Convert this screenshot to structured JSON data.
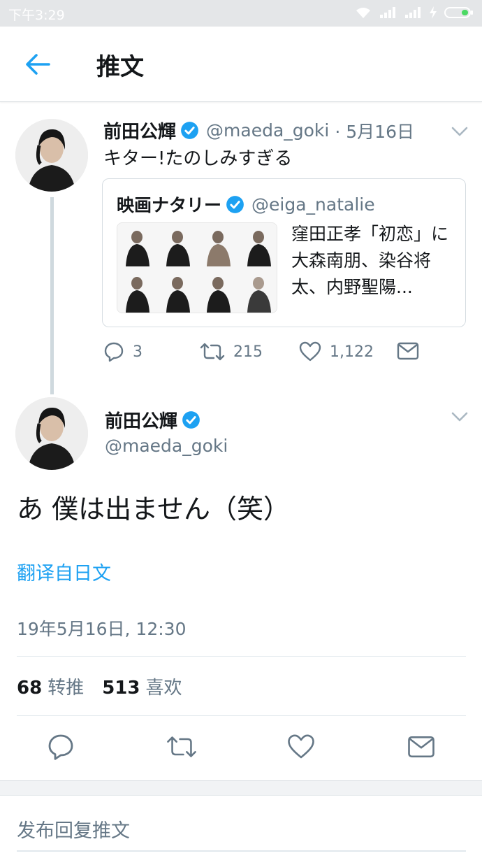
{
  "status_bar": {
    "time": "下午3:29"
  },
  "header": {
    "title": "推文"
  },
  "parent_tweet": {
    "name": "前田公輝",
    "handle": "@maeda_goki",
    "date": "· 5月16日",
    "text": "キター!たのしみすぎる",
    "quote": {
      "name": "映画ナタリー",
      "handle": "@eiga_natalie",
      "text": "窪田正孝「初恋」に大森南朋、染谷将太、内野聖陽..."
    },
    "counts": {
      "replies": "3",
      "retweets": "215",
      "likes": "1,122"
    }
  },
  "main_tweet": {
    "name": "前田公輝",
    "handle": "@maeda_goki",
    "text": "あ 僕は出ません（笑）",
    "translate_label": "翻译自日文",
    "timestamp": "19年5月16日, 12:30",
    "retweet_count": "68",
    "retweet_label": "转推",
    "like_count": "513",
    "like_label": "喜欢"
  },
  "reply_box": {
    "placeholder": "发布回复推文"
  },
  "colors": {
    "accent": "#1da1f2",
    "muted": "#657786",
    "text": "#14171a",
    "verified": "#1da1f2"
  },
  "icons": [
    "back-arrow-icon",
    "verified-icon",
    "chevron-down-icon",
    "reply-icon",
    "retweet-icon",
    "like-icon",
    "message-icon",
    "wifi-icon",
    "signal-icon",
    "battery-icon"
  ]
}
